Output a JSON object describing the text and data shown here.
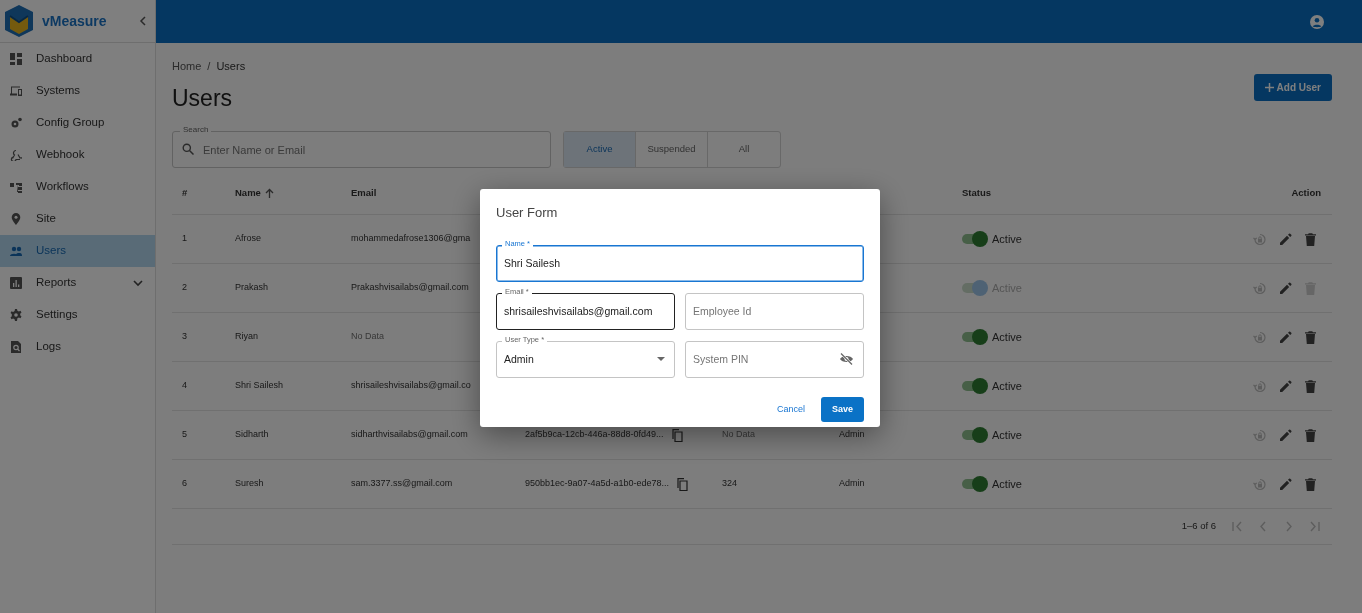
{
  "app": {
    "name": "vMeasure"
  },
  "sidebar": {
    "items": [
      {
        "label": "Dashboard",
        "selected": false,
        "kind": "link"
      },
      {
        "label": "Systems",
        "selected": false,
        "kind": "link"
      },
      {
        "label": "Config Group",
        "selected": false,
        "kind": "link"
      },
      {
        "label": "Webhook",
        "selected": false,
        "kind": "link"
      },
      {
        "label": "Workflows",
        "selected": false,
        "kind": "link"
      },
      {
        "label": "Site",
        "selected": false,
        "kind": "link"
      },
      {
        "label": "Users",
        "selected": true,
        "kind": "link"
      },
      {
        "label": "Reports",
        "selected": false,
        "kind": "group"
      },
      {
        "label": "Settings",
        "selected": false,
        "kind": "link"
      },
      {
        "label": "Logs",
        "selected": false,
        "kind": "link"
      }
    ]
  },
  "breadcrumb": {
    "items": [
      "Home",
      "Users"
    ],
    "separator": "/"
  },
  "title": "Users",
  "add_button": "Add User",
  "search": {
    "label": "Search",
    "placeholder": "Enter Name or Email"
  },
  "filters": [
    {
      "label": "Active",
      "selected": true
    },
    {
      "label": "Suspended",
      "selected": false
    },
    {
      "label": "All",
      "selected": false
    }
  ],
  "table": {
    "columns": [
      {
        "label": "#"
      },
      {
        "label": "Name",
        "sorted": true
      },
      {
        "label": "Email"
      },
      {
        "label": "Status"
      },
      {
        "label": "Action"
      }
    ],
    "rows": [
      {
        "number": "1",
        "name": "Afrose",
        "email": "mohammedafrose1306@gma",
        "status": {
          "label": "Active",
          "on": true,
          "disabled": false
        },
        "delete_disabled": false
      },
      {
        "number": "2",
        "name": "Prakash",
        "email": "Prakashvisailabs@gmail.com",
        "status": {
          "label": "Active",
          "on": true,
          "disabled": true
        },
        "delete_disabled": true
      },
      {
        "number": "3",
        "name": "Riyan",
        "email": "No Data",
        "email_empty": true,
        "status": {
          "label": "Active",
          "on": true,
          "disabled": false
        },
        "delete_disabled": false
      },
      {
        "number": "4",
        "name": "Shri Sailesh",
        "email": "shrisaileshvisailabs@gmail.co",
        "status": {
          "label": "Active",
          "on": true,
          "disabled": false
        },
        "delete_disabled": false
      },
      {
        "number": "5",
        "name": "Sidharth",
        "email": "sidharthvisailabs@gmail.com",
        "user_id": "2af5b9ca-12cb-446a-88d8-0fd49...",
        "employee_id": "No Data",
        "employee_empty": true,
        "user_type": "Admin",
        "status": {
          "label": "Active",
          "on": true,
          "disabled": false
        },
        "delete_disabled": false
      },
      {
        "number": "6",
        "name": "Suresh",
        "email": "sam.3377.ss@gmail.com",
        "user_id": "950bb1ec-9a07-4a5d-a1b0-ede78...",
        "employee_id": "324",
        "employee_empty": false,
        "user_type": "Admin",
        "status": {
          "label": "Active",
          "on": true,
          "disabled": false
        },
        "delete_disabled": false
      }
    ]
  },
  "pagination": {
    "range": "1–6 of 6"
  },
  "dialog": {
    "title": "User Form",
    "fields": [
      {
        "kind": "text",
        "label": "Name *",
        "value": "Shri Sailesh",
        "focused": true,
        "wide": true
      },
      {
        "kind": "text",
        "label": "Email *",
        "value": "shrisaileshvisailabs@gmail.com",
        "focused": false,
        "hovered": true
      },
      {
        "kind": "text",
        "placeholder": "Employee Id",
        "focused": false
      },
      {
        "kind": "select",
        "label": "User Type *",
        "value": "Admin",
        "focused": false
      },
      {
        "kind": "password",
        "placeholder": "System PIN",
        "focused": false
      }
    ],
    "cancel": "Cancel",
    "save": "Save"
  }
}
